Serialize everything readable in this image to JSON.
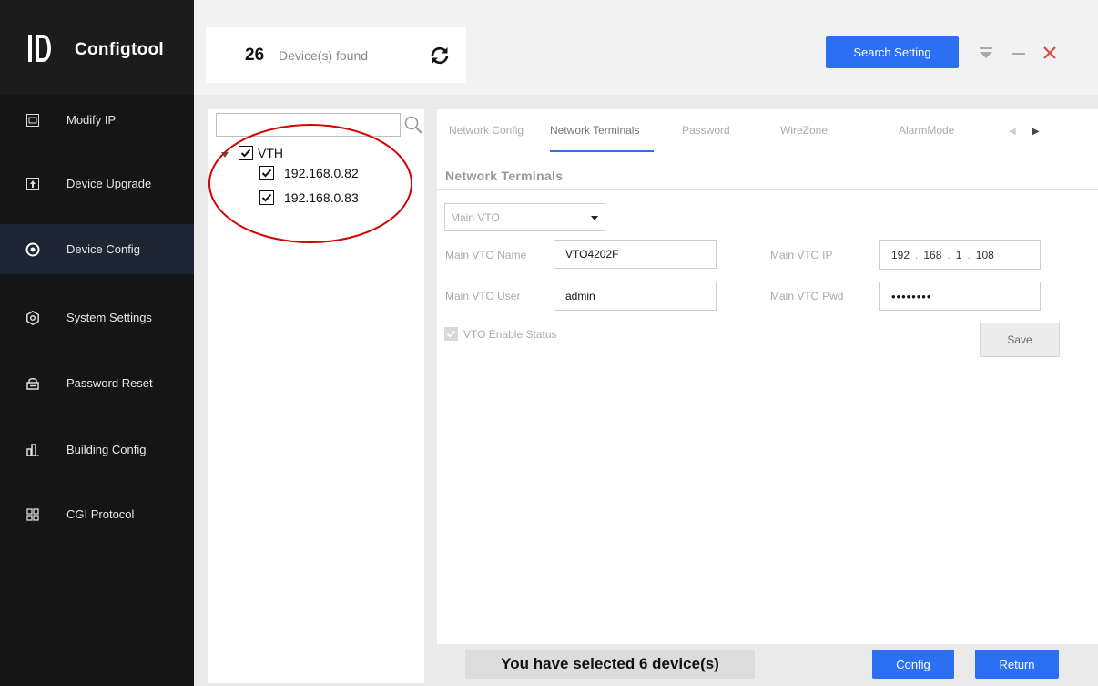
{
  "app": {
    "title": "Configtool"
  },
  "header": {
    "device_count": "26",
    "device_count_label": "Device(s) found",
    "search_setting_label": "Search Setting"
  },
  "sidebar": {
    "items": [
      {
        "label": "Modify IP",
        "icon": "ip-icon",
        "active": false
      },
      {
        "label": "Device Upgrade",
        "icon": "upgrade-icon",
        "active": false
      },
      {
        "label": "Device Config",
        "icon": "target-icon",
        "active": true
      },
      {
        "label": "System Settings",
        "icon": "gear-icon",
        "active": false
      },
      {
        "label": "Password Reset",
        "icon": "lock-icon",
        "active": false
      },
      {
        "label": "Building Config",
        "icon": "building-icon",
        "active": false
      },
      {
        "label": "CGI Protocol",
        "icon": "grid-icon",
        "active": false
      }
    ]
  },
  "tree": {
    "search_placeholder": "",
    "group": {
      "label": "VTH",
      "checked": true
    },
    "devices": [
      {
        "label": "192.168.0.82",
        "checked": true
      },
      {
        "label": "192.168.0.83",
        "checked": true
      }
    ]
  },
  "tabs": [
    "Network Config",
    "Network Terminals",
    "Password",
    "WireZone",
    "AlarmMode"
  ],
  "active_tab": "Network Terminals",
  "section": {
    "title": "Network Terminals",
    "select_value": "Main VTO",
    "main_vto_name_label": "Main VTO Name",
    "main_vto_name": "VTO4202F",
    "main_vto_ip_label": "Main VTO IP",
    "main_vto_ip": [
      "192",
      "168",
      "1",
      "108"
    ],
    "main_vto_user_label": "Main VTO User",
    "main_vto_user": "admin",
    "main_vto_pwd_label": "Main VTO Pwd",
    "main_vto_pwd": "••••••••",
    "vto_enable_label": "VTO Enable Status",
    "save_label": "Save"
  },
  "footer": {
    "selected_text": "You have selected 6 device(s)",
    "config_label": "Config",
    "return_label": "Return"
  },
  "colors": {
    "accent": "#2b6ff3",
    "sidebar_bg": "#151515",
    "close": "#e04848",
    "annotation": "#d60000"
  }
}
